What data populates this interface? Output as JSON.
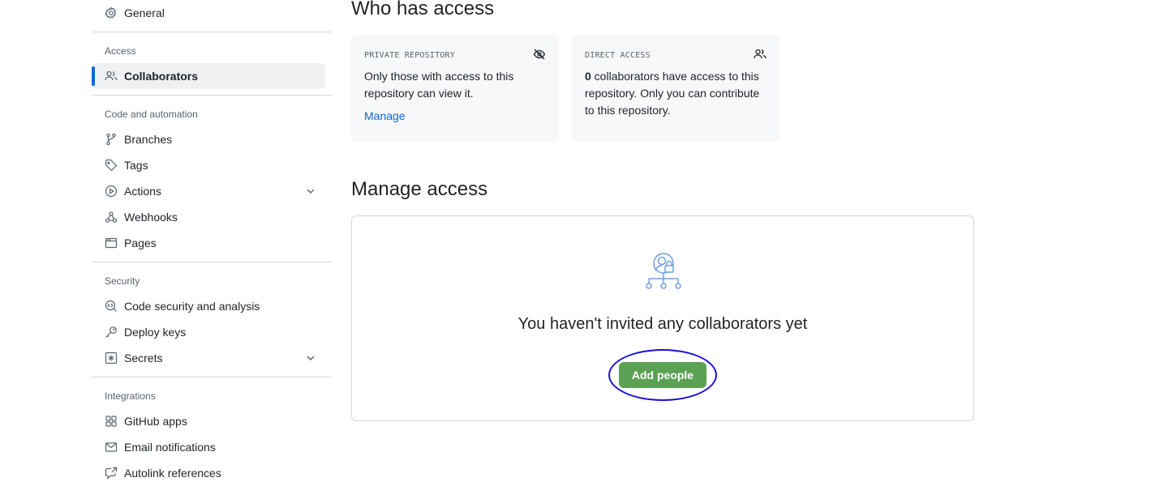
{
  "sidebar": {
    "general": "General",
    "access_title": "Access",
    "collaborators": "Collaborators",
    "code_title": "Code and automation",
    "branches": "Branches",
    "tags": "Tags",
    "actions": "Actions",
    "webhooks": "Webhooks",
    "pages": "Pages",
    "security_title": "Security",
    "code_security": "Code security and analysis",
    "deploy_keys": "Deploy keys",
    "secrets": "Secrets",
    "integrations_title": "Integrations",
    "github_apps": "GitHub apps",
    "email_notifications": "Email notifications",
    "autolink": "Autolink references"
  },
  "who_has_access": {
    "title": "Who has access",
    "private_card": {
      "label": "PRIVATE REPOSITORY",
      "text": "Only those with access to this repository can view it.",
      "link": "Manage"
    },
    "direct_card": {
      "label": "DIRECT ACCESS",
      "count": "0",
      "text": " collaborators have access to this repository. Only you can contribute to this repository."
    }
  },
  "manage_access": {
    "title": "Manage access",
    "empty_title": "You haven't invited any collaborators yet",
    "add_button": "Add people"
  },
  "colors": {
    "accent": "#0969da",
    "button": "#5ba153",
    "highlight": "#1a10d8"
  },
  "icons": [
    "gear-icon",
    "people-icon",
    "git-branch-icon",
    "tag-icon",
    "play-icon",
    "webhook-icon",
    "browser-icon",
    "codescan-icon",
    "key-icon",
    "asterisk-icon",
    "apps-icon",
    "mail-icon",
    "cross-reference-icon",
    "eye-closed-icon",
    "chevron-down-icon",
    "collaborators-illustration"
  ]
}
